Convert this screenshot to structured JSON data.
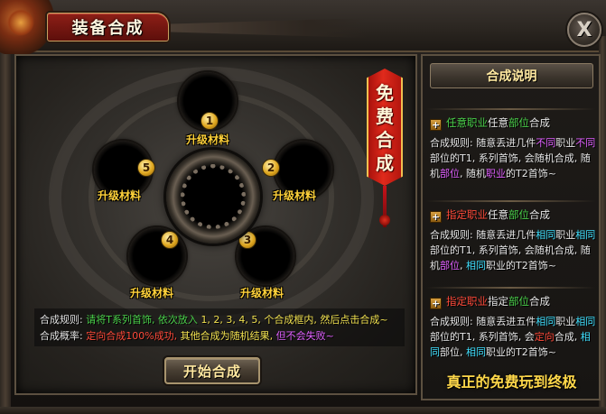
{
  "window": {
    "title": "装备合成",
    "close_label": "X"
  },
  "free_banner": {
    "line1": "免费",
    "line2": "合成"
  },
  "slots": [
    {
      "number": "",
      "label": ""
    },
    {
      "number": "1",
      "label": "升级材料"
    },
    {
      "number": "2",
      "label": "升级材料"
    },
    {
      "number": "3",
      "label": "升级材料"
    },
    {
      "number": "4",
      "label": "升级材料"
    },
    {
      "number": "5",
      "label": "升级材料"
    }
  ],
  "rules": {
    "rule_label": "合成规则:",
    "rule_part1": "请将T系列首饰, 依次放入",
    "rule_part2": "1, 2, 3, 4, 5, 个合成框内, 然后点击合成~",
    "prob_label": "合成概率:",
    "prob_part1": "定向合成100%成功,",
    "prob_part2": "其他合成为随机结果,",
    "prob_part3": "但不会失败~"
  },
  "start_button": {
    "label": "开始合成"
  },
  "info_panel": {
    "header": "合成说明",
    "sections": [
      {
        "title_a": "任意职业",
        "title_b": "任意",
        "title_c": "部位",
        "title_d": "合成",
        "body": [
          {
            "t": "合成规则: 随意丢进几件",
            "c": "white"
          },
          {
            "t": "不同",
            "c": "magenta"
          },
          {
            "t": "职业",
            "c": "white"
          },
          {
            "t": "不同",
            "c": "magenta"
          },
          {
            "t": "部位的T1, 系列首饰, 会随机合成, 随机",
            "c": "white"
          },
          {
            "t": "部位",
            "c": "magenta"
          },
          {
            "t": ", 随机",
            "c": "white"
          },
          {
            "t": "职业",
            "c": "magenta"
          },
          {
            "t": "的T2首饰~",
            "c": "white"
          }
        ]
      },
      {
        "title_a": "指定职业",
        "title_b": "任意",
        "title_c": "部位",
        "title_d": "合成",
        "body": [
          {
            "t": "合成规则: 随意丢进几件",
            "c": "white"
          },
          {
            "t": "相同",
            "c": "cyan"
          },
          {
            "t": "职业",
            "c": "white"
          },
          {
            "t": "相同",
            "c": "cyan"
          },
          {
            "t": "部位的T1, 系列首饰, 会随机合成, 随机",
            "c": "white"
          },
          {
            "t": "部位",
            "c": "magenta"
          },
          {
            "t": ", ",
            "c": "white"
          },
          {
            "t": "相同",
            "c": "cyan"
          },
          {
            "t": "职业的T2首饰~",
            "c": "white"
          }
        ]
      },
      {
        "title_a": "指定职业",
        "title_b": "指定",
        "title_c": "部位",
        "title_d": "合成",
        "body": [
          {
            "t": "合成规则: 随意丢进五件",
            "c": "white"
          },
          {
            "t": "相同",
            "c": "cyan"
          },
          {
            "t": "职业",
            "c": "white"
          },
          {
            "t": "相同",
            "c": "cyan"
          },
          {
            "t": "部位的T1, 系列首饰, 会",
            "c": "white"
          },
          {
            "t": "定向",
            "c": "red"
          },
          {
            "t": "合成, ",
            "c": "white"
          },
          {
            "t": "相同",
            "c": "cyan"
          },
          {
            "t": "部位, ",
            "c": "white"
          },
          {
            "t": "相同",
            "c": "cyan"
          },
          {
            "t": "职业的T2首饰~",
            "c": "white"
          }
        ]
      }
    ],
    "slogan": "真正的免费玩到终极"
  },
  "colors": {
    "accent_red": "#8e1f17",
    "gold": "#ffd23a",
    "green": "#4ad04a",
    "magenta": "#e060ff",
    "cyan": "#40e0ff",
    "red": "#ff4a3a"
  }
}
